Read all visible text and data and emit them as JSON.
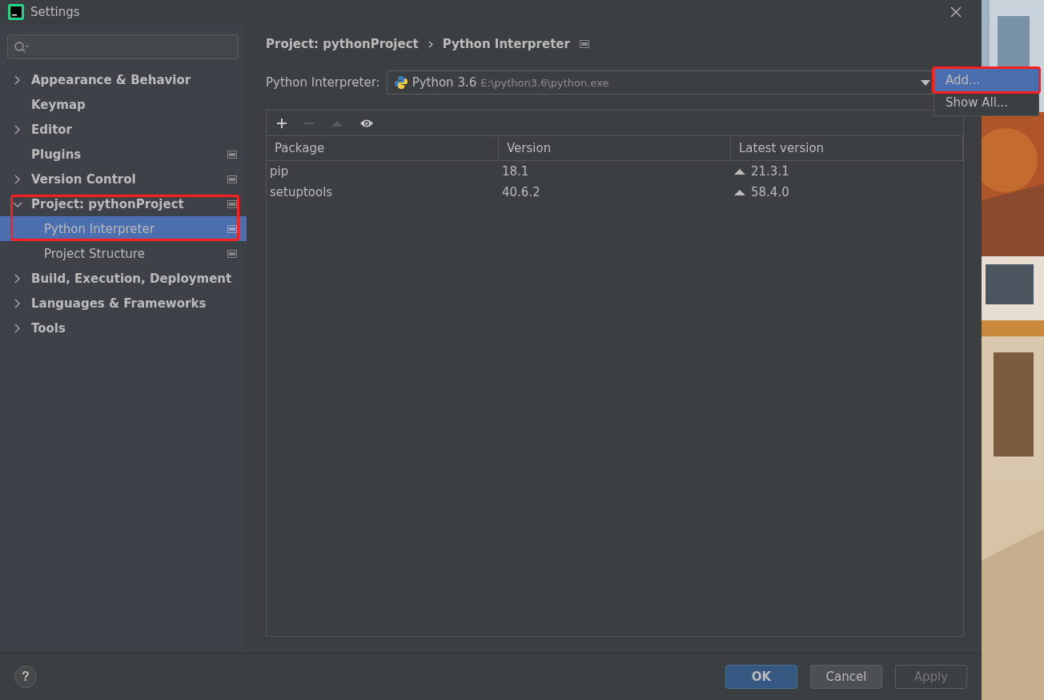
{
  "window": {
    "title": "Settings"
  },
  "tree": [
    {
      "label": "Appearance & Behavior",
      "expanded": false,
      "selected": false,
      "project_scope": false,
      "highlighted": false
    },
    {
      "label": "Keymap",
      "selected": false,
      "project_scope": false,
      "highlighted": false
    },
    {
      "label": "Editor",
      "expanded": false,
      "selected": false,
      "project_scope": false,
      "highlighted": false
    },
    {
      "label": "Plugins",
      "selected": false,
      "project_scope": true,
      "highlighted": false
    },
    {
      "label": "Version Control",
      "expanded": false,
      "selected": false,
      "project_scope": true,
      "highlighted": false
    },
    {
      "label": "Project: pythonProject",
      "expanded": true,
      "selected": false,
      "project_scope": true,
      "highlighted": true,
      "children": [
        {
          "label": "Python Interpreter",
          "selected": true,
          "project_scope": true
        },
        {
          "label": "Project Structure",
          "selected": false,
          "project_scope": true
        }
      ]
    },
    {
      "label": "Build, Execution, Deployment",
      "expanded": false,
      "selected": false,
      "project_scope": false,
      "highlighted": false
    },
    {
      "label": "Languages & Frameworks",
      "expanded": false,
      "selected": false,
      "project_scope": false,
      "highlighted": false
    },
    {
      "label": "Tools",
      "expanded": false,
      "selected": false,
      "project_scope": false,
      "highlighted": false
    }
  ],
  "breadcrumb": [
    "Project: pythonProject",
    "Python Interpreter"
  ],
  "interpreter": {
    "label": "Python Interpreter:",
    "name": "Python 3.6",
    "path": "E:\\python3.6\\python.exe"
  },
  "popup": [
    {
      "label": "Add...",
      "selected": true,
      "highlighted": true
    },
    {
      "label": "Show All...",
      "selected": false,
      "highlighted": false
    }
  ],
  "toolbar": [
    {
      "kind": "add",
      "disabled": false
    },
    {
      "kind": "remove",
      "disabled": true
    },
    {
      "kind": "upgrade",
      "disabled": true
    },
    {
      "kind": "show",
      "disabled": false
    }
  ],
  "table": {
    "columns": [
      "Package",
      "Version",
      "Latest version"
    ],
    "rows": [
      {
        "package": "pip",
        "version": "18.1",
        "latest": "21.3.1",
        "upgrade": true
      },
      {
        "package": "setuptools",
        "version": "40.6.2",
        "latest": "58.4.0",
        "upgrade": true
      }
    ]
  },
  "help": "?",
  "buttons": [
    {
      "label": "OK",
      "kind": "primary",
      "disabled": false
    },
    {
      "label": "Cancel",
      "kind": "normal",
      "disabled": false
    },
    {
      "label": "Apply",
      "kind": "normal",
      "disabled": true
    }
  ]
}
